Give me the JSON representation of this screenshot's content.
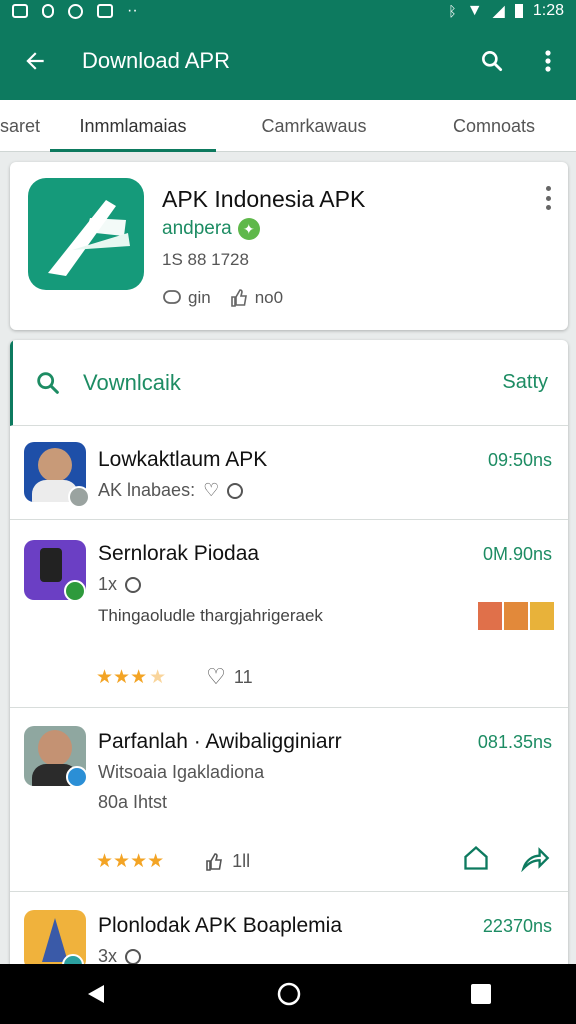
{
  "status_bar": {
    "time": "1:28"
  },
  "app_bar": {
    "title": "Download APR"
  },
  "tabs": [
    {
      "label": "saret",
      "active": false
    },
    {
      "label": "Inmmlamaias",
      "active": true
    },
    {
      "label": "Camrkawaus",
      "active": false
    },
    {
      "label": "Comnoats",
      "active": false
    }
  ],
  "featured": {
    "name": "APK Indonesia APK",
    "developer": "andpera",
    "meta": "1S 88 1728",
    "stat1": "gin",
    "stat2": "no0"
  },
  "search": {
    "text": "Vownlcaik",
    "sort_label": "Satty"
  },
  "list": [
    {
      "title": "Lowkaktlaum APK",
      "size": "09:50ns",
      "sub": "AK lnabaes:"
    },
    {
      "title": "Sernlorak Piodaa",
      "size": "0M.90ns",
      "sub": "1x",
      "desc": "Thingaoludle thargjahrigeraek",
      "likes": "11"
    },
    {
      "title": "Parfanlah · Awibaligginiarr",
      "size": "081.35ns",
      "sub": "Witsoaia Igakladiona",
      "desc": "80a Ihtst",
      "likes": "1ll"
    },
    {
      "title": "Plonlodak APK Boaplemia",
      "size": "22370ns",
      "sub": "3x"
    }
  ],
  "colors": {
    "primary": "#0d7a5f",
    "accent_text": "#1d8c63",
    "star": "#f3a425"
  }
}
